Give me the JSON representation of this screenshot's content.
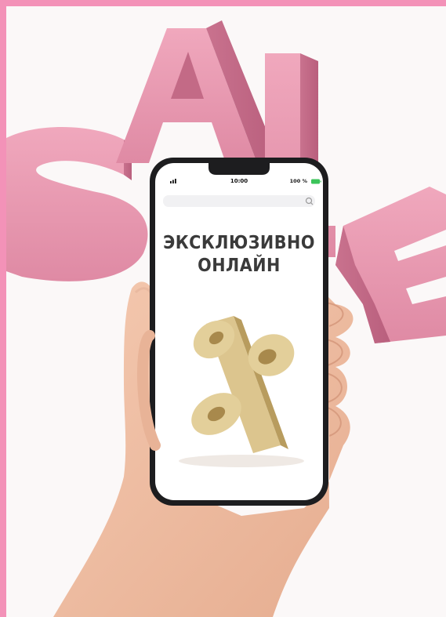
{
  "phone": {
    "status_time": "10:00",
    "battery_text": "100 %",
    "headline_line1": "ЭКСКЛЮЗИВНО",
    "headline_line2": "ОНЛАЙН"
  },
  "colors": {
    "border": "#f392b8",
    "letters": "#e48da8",
    "percent": "#d9c188",
    "background": "#fbf8f8"
  },
  "icons": [
    "signal-icon",
    "battery-icon",
    "search-icon",
    "percent-sign-icon"
  ]
}
